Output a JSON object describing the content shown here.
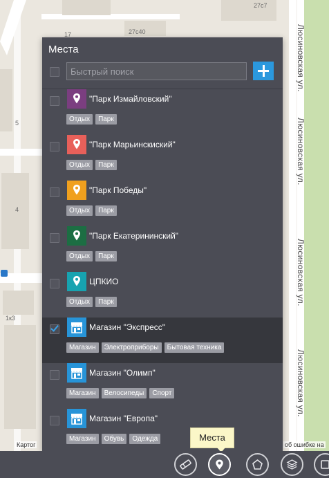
{
  "map": {
    "building_labels": [
      "27с7",
      "17",
      "27с40",
      "5",
      "4",
      "1к3"
    ],
    "street_name": "Люсиновская ул.",
    "attribution_left": "Картог",
    "attribution_right": "об ошибке на"
  },
  "panel": {
    "title": "Места",
    "search_placeholder": "Быстрый поиск",
    "add_icon": "plus-icon"
  },
  "places": [
    {
      "name": "\"Парк Измайловский\"",
      "color": "#7b3e80",
      "icon": "map-pin-icon",
      "checked": false,
      "tags": [
        "Отдых",
        "Парк"
      ]
    },
    {
      "name": "\"Парк Марьинскиский\"",
      "color": "#e8605a",
      "icon": "map-pin-icon",
      "checked": false,
      "tags": [
        "Отдых",
        "Парк"
      ]
    },
    {
      "name": "\"Парк Победы\"",
      "color": "#f0a01e",
      "icon": "map-pin-icon",
      "checked": false,
      "tags": [
        "Отдых",
        "Парк"
      ]
    },
    {
      "name": "\"Парк Екатерининский\"",
      "color": "#1c6e43",
      "icon": "map-pin-icon",
      "checked": false,
      "tags": [
        "Отдых",
        "Парк"
      ]
    },
    {
      "name": "ЦПКИО",
      "color": "#17a3b0",
      "icon": "map-pin-icon",
      "checked": false,
      "tags": [
        "Отдых",
        "Парк"
      ]
    },
    {
      "name": "Магазин \"Экспресс\"",
      "color": "#2794d8",
      "icon": "store-icon",
      "checked": true,
      "tags": [
        "Магазин",
        "Электроприборы",
        "Бытовая техника"
      ]
    },
    {
      "name": "Магазин \"Олимп\"",
      "color": "#2794d8",
      "icon": "store-icon",
      "checked": false,
      "tags": [
        "Магазин",
        "Велосипеды",
        "Спорт"
      ]
    },
    {
      "name": "Магазин \"Европа\"",
      "color": "#2794d8",
      "icon": "store-icon",
      "checked": false,
      "tags": [
        "Магазин",
        "Обувь",
        "Одежда"
      ]
    }
  ],
  "toolbar": {
    "tooltip": "Места",
    "tools": [
      "eraser-icon",
      "map-pin-icon",
      "polygon-icon",
      "layers-icon",
      "square-icon"
    ]
  }
}
